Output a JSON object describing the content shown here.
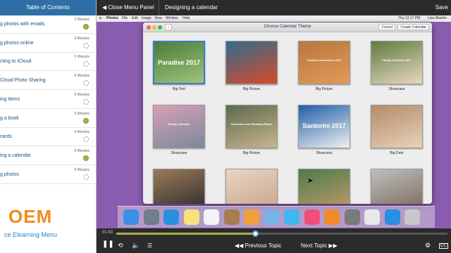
{
  "toc": {
    "header": "Table of Contents",
    "items": [
      {
        "title": "g photos with emails",
        "duration": "3 Minutes",
        "status": "done"
      },
      {
        "title": "g photos online",
        "duration": "4 Minutes",
        "status": "todo"
      },
      {
        "title": "cting to iCloud",
        "duration": "5 Minutes",
        "status": "todo"
      },
      {
        "title": "Cloud Photo Sharing",
        "duration": "5 Minutes",
        "status": "todo"
      },
      {
        "title": "ing items",
        "duration": "5 Minutes",
        "status": "todo"
      },
      {
        "title": "g a book",
        "duration": "5 Minutes",
        "status": "done"
      },
      {
        "title": "cards",
        "duration": "4 Minutes",
        "status": "todo"
      },
      {
        "title": "ing a calendar",
        "duration": "5 Minutes",
        "status": "done"
      },
      {
        "title": "g photos",
        "duration": "6 Minutes",
        "status": "todo"
      }
    ]
  },
  "logo": {
    "big": "OEM",
    "sub": "ce Elearning Menu",
    "color": "#f18a1c"
  },
  "topbar": {
    "close_menu": "Close Menu Panel",
    "lesson_title": "Designing a calendar",
    "save": "Save"
  },
  "mac_menubar": {
    "items": [
      "Photos",
      "File",
      "Edit",
      "Image",
      "View",
      "Window",
      "Help"
    ],
    "time": "Thu 12:17 PM",
    "user": "Lisa Washin"
  },
  "dialog": {
    "title": "Choose Calendar Theme",
    "cancel": "Cancel",
    "create": "Create Calendar",
    "themes": [
      {
        "label": "Big Text",
        "caption": "Paradise 2017",
        "colors": [
          "#4a7d3b",
          "#9fc47a"
        ],
        "selected": true
      },
      {
        "label": "Big Picture",
        "caption": "",
        "colors": [
          "#2e6c8e",
          "#d84a2a"
        ],
        "selected": false
      },
      {
        "label": "Big Picture",
        "caption": "Outdoor Adventures 2017",
        "colors": [
          "#b9763f",
          "#e19a56"
        ],
        "selected": false
      },
      {
        "label": "Showcase",
        "caption": "Family Calendar 2017",
        "colors": [
          "#5d7c3e",
          "#e9d7c0"
        ],
        "selected": false
      },
      {
        "label": "Showcase",
        "caption": "Family Calendar",
        "colors": [
          "#d8a0b5",
          "#7a8a9a"
        ],
        "selected": false
      },
      {
        "label": "Big Picture",
        "caption": "Adventure and Faraway Places",
        "colors": [
          "#5b6b4e",
          "#c9b48c"
        ],
        "selected": false
      },
      {
        "label": "Showcase",
        "caption": "Santorini 2017",
        "colors": [
          "#1f5ea8",
          "#f1f1f1"
        ],
        "selected": false
      },
      {
        "label": "Big Date",
        "caption": "",
        "colors": [
          "#b38a6a",
          "#e8d2b8"
        ],
        "selected": false
      },
      {
        "label": "",
        "caption": "",
        "colors": [
          "#9c7a5a",
          "#2c2c2c"
        ],
        "selected": false
      },
      {
        "label": "",
        "caption": "",
        "colors": [
          "#e8d5c5",
          "#c7a58a"
        ],
        "selected": false
      },
      {
        "label": "",
        "caption": "",
        "colors": [
          "#4a7c4a",
          "#c59a6a"
        ],
        "selected": false
      },
      {
        "label": "",
        "caption": "",
        "colors": [
          "#bfbfbf",
          "#7a6a5a"
        ],
        "selected": false
      }
    ]
  },
  "dock": {
    "apps": [
      {
        "name": "finder-icon",
        "color": "#3d8ee8"
      },
      {
        "name": "launchpad-icon",
        "color": "#6f7d8c"
      },
      {
        "name": "safari-icon",
        "color": "#2a8fe0"
      },
      {
        "name": "notes-icon",
        "color": "#f7e27a"
      },
      {
        "name": "reminders-icon",
        "color": "#f4f4f4"
      },
      {
        "name": "contacts-icon",
        "color": "#a67c52"
      },
      {
        "name": "photos-icon",
        "color": "#f2a03d"
      },
      {
        "name": "preview-icon",
        "color": "#7ab3e6"
      },
      {
        "name": "messages-icon",
        "color": "#3fb8f0"
      },
      {
        "name": "itunes-icon",
        "color": "#f04e7a"
      },
      {
        "name": "ibooks-icon",
        "color": "#f08a2a"
      },
      {
        "name": "system-preferences-icon",
        "color": "#7a7a7a"
      },
      {
        "name": "textedit-icon",
        "color": "#e8e8e8"
      },
      {
        "name": "app-store-icon",
        "color": "#2a8fe0"
      },
      {
        "name": "trash-icon",
        "color": "#c8c8c8"
      }
    ]
  },
  "player": {
    "time": "01:43",
    "progress": 0.42,
    "prev_topic": "Previous Topic",
    "next_topic": "Next Topic",
    "cc": "CC"
  }
}
